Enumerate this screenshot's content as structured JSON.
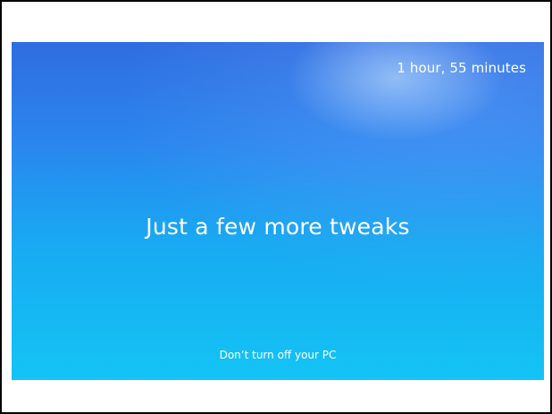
{
  "setup_screen": {
    "time_remaining": "1 hour, 55 minutes",
    "headline": "Just a few more tweaks",
    "warning": "Don’t turn off your PC"
  },
  "colors": {
    "screen_top": "#2f6de0",
    "screen_bottom": "#13c4f4",
    "text": "#ffffff"
  }
}
